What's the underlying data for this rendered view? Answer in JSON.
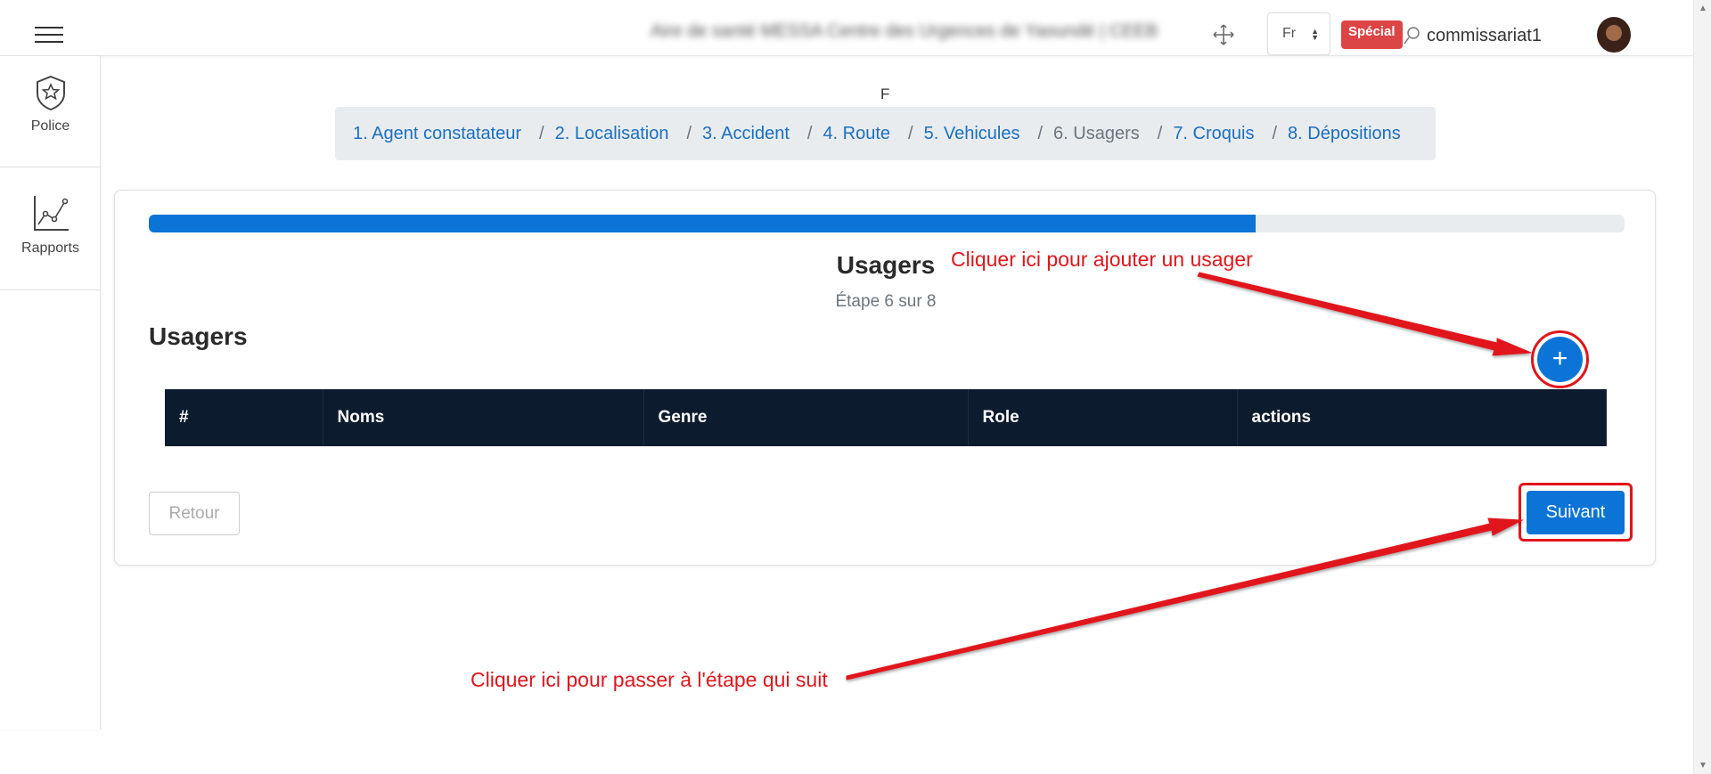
{
  "header": {
    "facility": "Aire de santé MESSA Centre des Urgences de Yaoundé | CEEB",
    "lang": "Fr",
    "badge": "Spécial",
    "username": "commissariat1"
  },
  "sidebar": {
    "items": [
      {
        "label": "Police",
        "icon": "police-badge-icon"
      },
      {
        "label": "Rapports",
        "icon": "line-chart-icon"
      }
    ]
  },
  "wizard": {
    "marker": "F",
    "steps": [
      {
        "label": "1. Agent constatateur",
        "active": false
      },
      {
        "label": "2. Localisation",
        "active": false
      },
      {
        "label": "3. Accident",
        "active": false
      },
      {
        "label": "4. Route",
        "active": false
      },
      {
        "label": "5. Vehicules",
        "active": false
      },
      {
        "label": "6. Usagers",
        "active": true
      },
      {
        "label": "7. Croquis",
        "active": false
      },
      {
        "label": "8. Dépositions",
        "active": false
      }
    ],
    "separator": "/",
    "progress_fraction": 0.75,
    "title": "Usagers",
    "subtitle": "Étape 6 sur 8"
  },
  "section": {
    "title": "Usagers",
    "add_label": "+",
    "columns": [
      "#",
      "Noms",
      "Genre",
      "Role",
      "actions"
    ],
    "back_label": "Retour",
    "next_label": "Suivant"
  },
  "annotations": {
    "add_hint": "Cliquer ici pour ajouter un usager",
    "next_hint": "Cliquer ici pour passer à l'étape qui suit",
    "color": "#e0151b"
  },
  "colors": {
    "primary": "#0b74d6",
    "table_header": "#0d1b2e",
    "badge": "#dc4545"
  }
}
